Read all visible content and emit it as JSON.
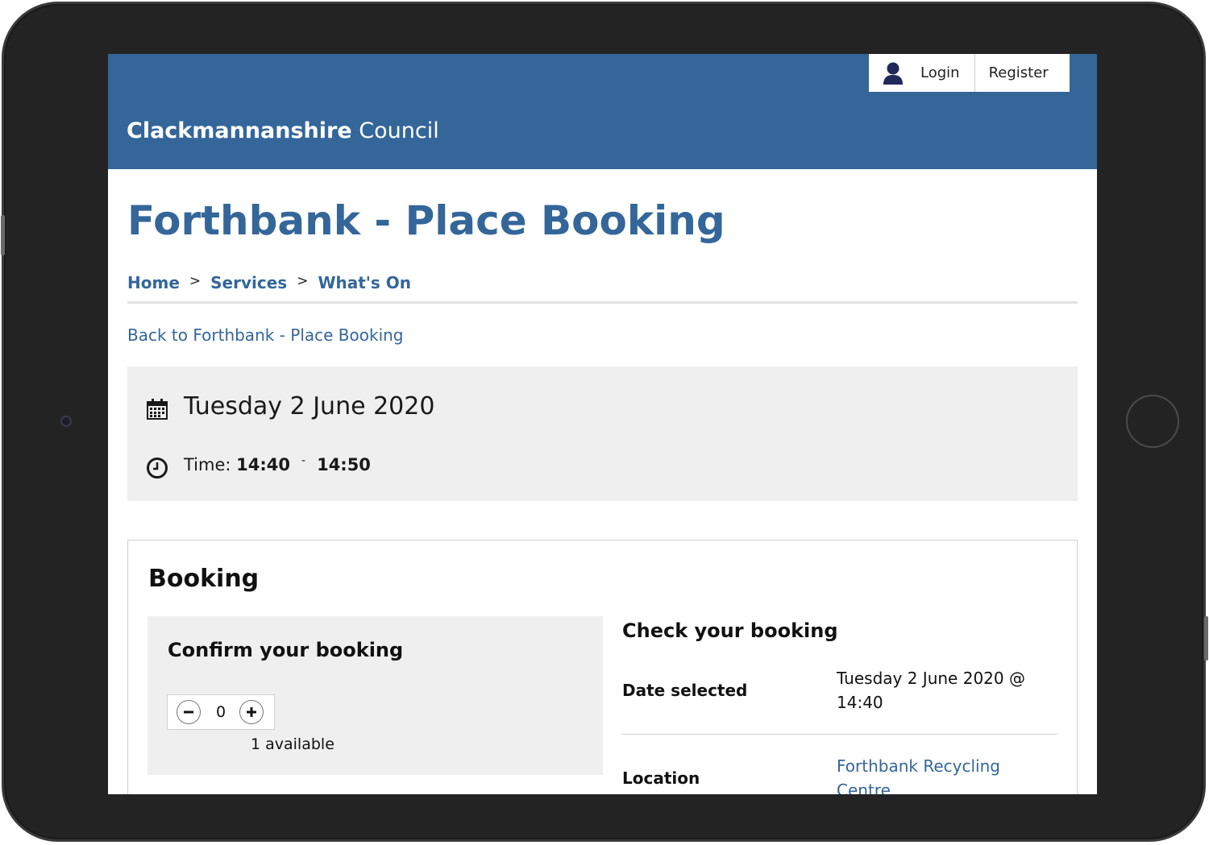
{
  "header": {
    "site_name_bold": "Clackmannanshire",
    "site_name_light": "Council",
    "login_label": "Login",
    "register_label": "Register",
    "brand_color": "#346699"
  },
  "page": {
    "title": "Forthbank - Place Booking",
    "breadcrumb": [
      {
        "label": "Home"
      },
      {
        "label": "Services"
      },
      {
        "label": "What's On"
      }
    ],
    "breadcrumb_separator": ">",
    "back_link": "Back to Forthbank - Place Booking"
  },
  "event": {
    "date": "Tuesday 2 June 2020",
    "time_label": "Time:",
    "start_time": "14:40",
    "time_separator": "-",
    "end_time": "14:50"
  },
  "booking": {
    "title": "Booking",
    "confirm_title": "Confirm your booking",
    "quantity": "0",
    "availability": "1 available",
    "check_title": "Check your booking",
    "date_selected_label": "Date selected",
    "date_selected_value": "Tuesday 2 June 2020 @ 14:40",
    "location_label": "Location",
    "location_value": "Forthbank Recycling Centre"
  },
  "icons": {
    "user": "user-icon",
    "calendar": "calendar-icon",
    "clock": "clock-icon",
    "minus": "minus-icon",
    "plus": "plus-icon"
  }
}
